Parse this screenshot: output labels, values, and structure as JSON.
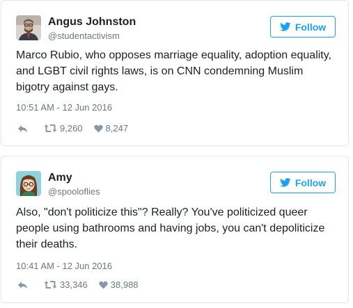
{
  "tweets": [
    {
      "name": "Angus Johnston",
      "handle": "@studentactivism",
      "follow_label": "Follow",
      "lines": [
        "Marco Rubio, who opposes marriage equality, adoption equality,",
        "and LGBT civil rights laws, is on CNN condemning Muslim",
        "bigotry against gays."
      ],
      "timestamp": "10:51 AM - 12 Jun 2016",
      "retweets": "9,260",
      "likes": "8,247"
    },
    {
      "name": "Amy",
      "handle": "@spooloflies",
      "follow_label": "Follow",
      "lines": [
        "Also, \"don't politicize this\"? Really? You've politicized queer",
        "people using bathrooms and having jobs, you can't depoliticize",
        "their deaths."
      ],
      "timestamp": "10:41 AM - 12 Jun 2016",
      "retweets": "33,346",
      "likes": "38,988"
    }
  ],
  "colors": {
    "accent": "#1da1f2",
    "muted": "#697882",
    "text": "#1c2022",
    "border": "#e1e8ed"
  },
  "icons": [
    "twitter-bird-icon",
    "reply-icon",
    "retweet-icon",
    "heart-icon"
  ]
}
